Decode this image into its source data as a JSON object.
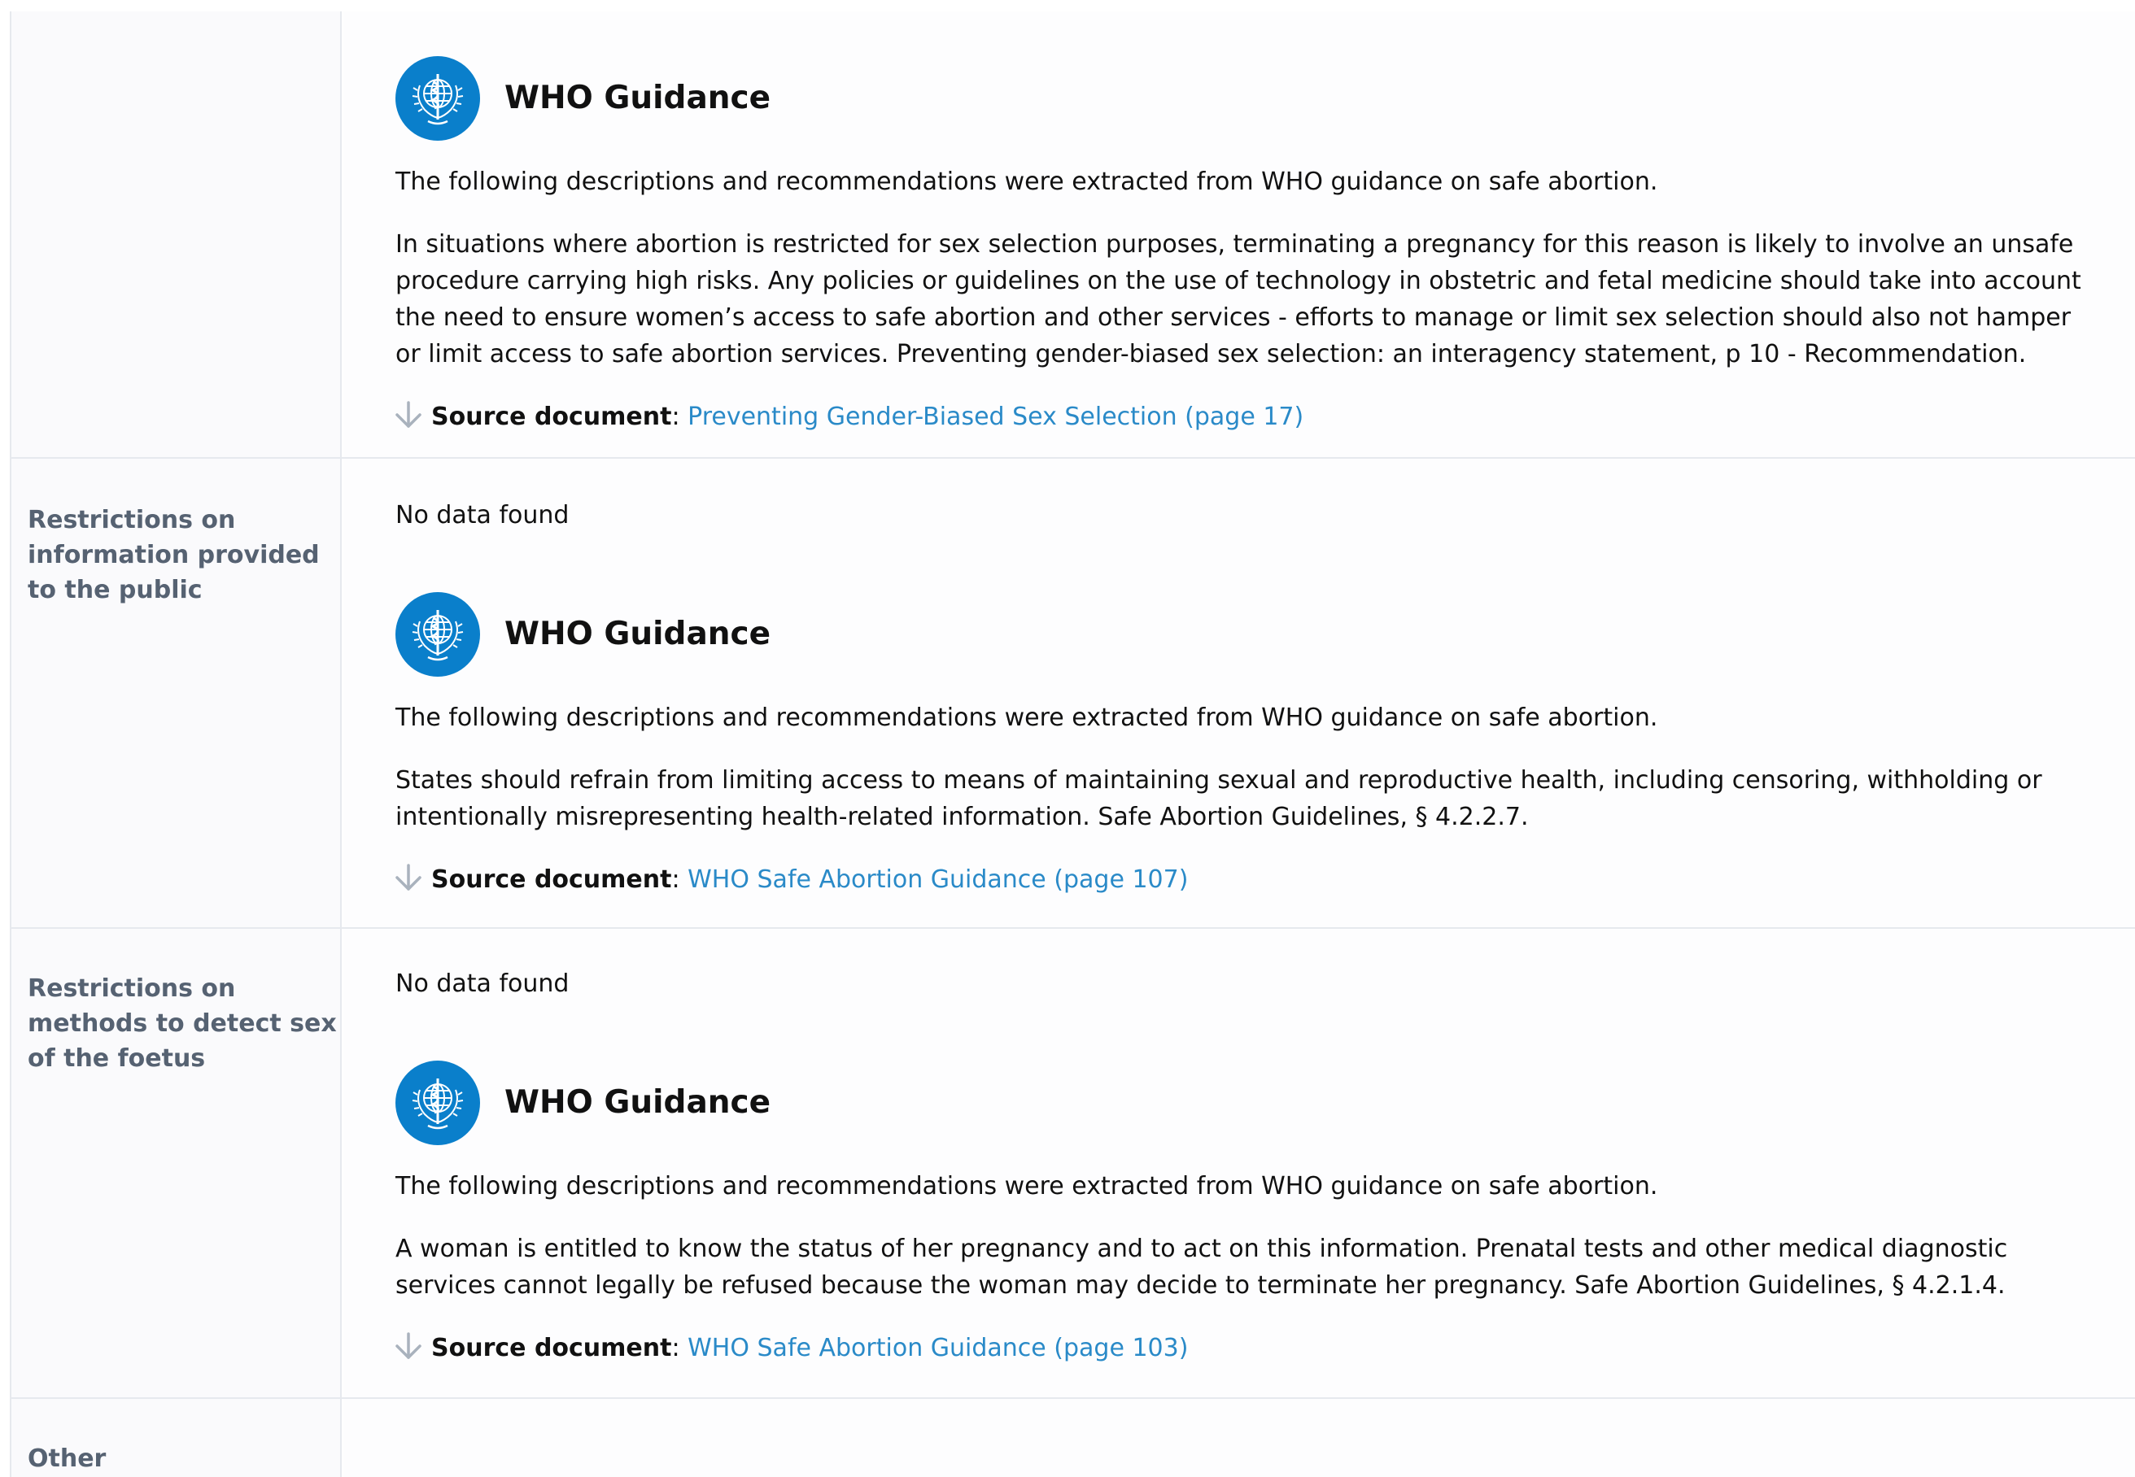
{
  "rows": [
    {
      "label": "",
      "no_data": "",
      "guidance": {
        "title": "WHO Guidance",
        "intro": "The following descriptions and recommendations were extracted from WHO guidance on safe abortion.",
        "text": "In situations where abortion is restricted for sex selection purposes, terminating a pregnancy for this reason is likely to involve an unsafe procedure carrying high risks. Any policies or guidelines on the use of technology in obstetric and fetal medicine should take into account the need to ensure women’s access to safe abortion and other services - efforts to manage or limit sex selection should also not hamper or limit access to safe abortion services. Preventing gender-biased sex selection: an interagency statement, p 10 - Recommendation.",
        "source_label": "Source document",
        "source_sep": ":",
        "source_link": "Preventing Gender-Biased Sex Selection (page 17)"
      }
    },
    {
      "label": "Restrictions on information provided to the public",
      "no_data": "No data found",
      "guidance": {
        "title": "WHO Guidance",
        "intro": "The following descriptions and recommendations were extracted from WHO guidance on safe abortion.",
        "text": "States should refrain from limiting access to means of maintaining sexual and reproductive health, including censoring, withholding or intentionally misrepresenting health-related information. Safe Abortion Guidelines, § 4.2.2.7.",
        "source_label": "Source document",
        "source_sep": ":",
        "source_link": "WHO Safe Abortion Guidance (page 107)"
      }
    },
    {
      "label": "Restrictions on methods to detect sex of the foetus",
      "no_data": "No data found",
      "guidance": {
        "title": "WHO Guidance",
        "intro": "The following descriptions and recommendations were extracted from WHO guidance on safe abortion.",
        "text": "A woman is entitled to know the status of her pregnancy and to act on this information. Prenatal tests and other medical diagnostic services cannot legally be refused because the woman may decide to terminate her pregnancy. Safe Abortion Guidelines, § 4.2.1.4.",
        "source_label": "Source document",
        "source_sep": ":",
        "source_link": "WHO Safe Abortion Guidance (page 103)"
      }
    },
    {
      "label": "Other",
      "no_data": ""
    }
  ],
  "colors": {
    "who_blue": "#0a7fcb",
    "link": "#2a8ac8",
    "label_text": "#566272",
    "border": "#e6e9ee"
  },
  "icons": {
    "logo": "who-emblem-icon",
    "source": "arrow-down-icon"
  }
}
